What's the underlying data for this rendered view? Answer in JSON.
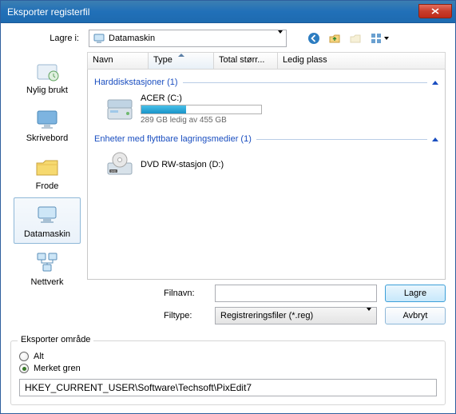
{
  "window": {
    "title": "Eksporter registerfil"
  },
  "toolbar": {
    "save_in_label": "Lagre i:",
    "location": "Datamaskin"
  },
  "columns": {
    "name": "Navn",
    "type": "Type",
    "total_size": "Total størr...",
    "free_space": "Ledig plass"
  },
  "groups": {
    "hdd": "Harddiskstasjoner (1)",
    "removable": "Enheter med flyttbare lagringsmedier (1)"
  },
  "drives": {
    "hdd1": {
      "name": "ACER (C:)",
      "free": "289 GB ledig av 455 GB",
      "used_pct": 37
    },
    "opt1": {
      "name": "DVD RW-stasjon (D:)"
    }
  },
  "places": {
    "recent": "Nylig brukt",
    "desktop": "Skrivebord",
    "user": "Frode",
    "computer": "Datamaskin",
    "network": "Nettverk"
  },
  "fields": {
    "filename_label": "Filnavn:",
    "filetype_label": "Filtype:",
    "filetype_value": "Registreringsfiler (*.reg)",
    "filename_value": ""
  },
  "buttons": {
    "save": "Lagre",
    "cancel": "Avbryt"
  },
  "export_range": {
    "group_label": "Eksporter område",
    "all": "Alt",
    "selected": "Merket gren",
    "branch": "HKEY_CURRENT_USER\\Software\\Techsoft\\PixEdit7"
  }
}
